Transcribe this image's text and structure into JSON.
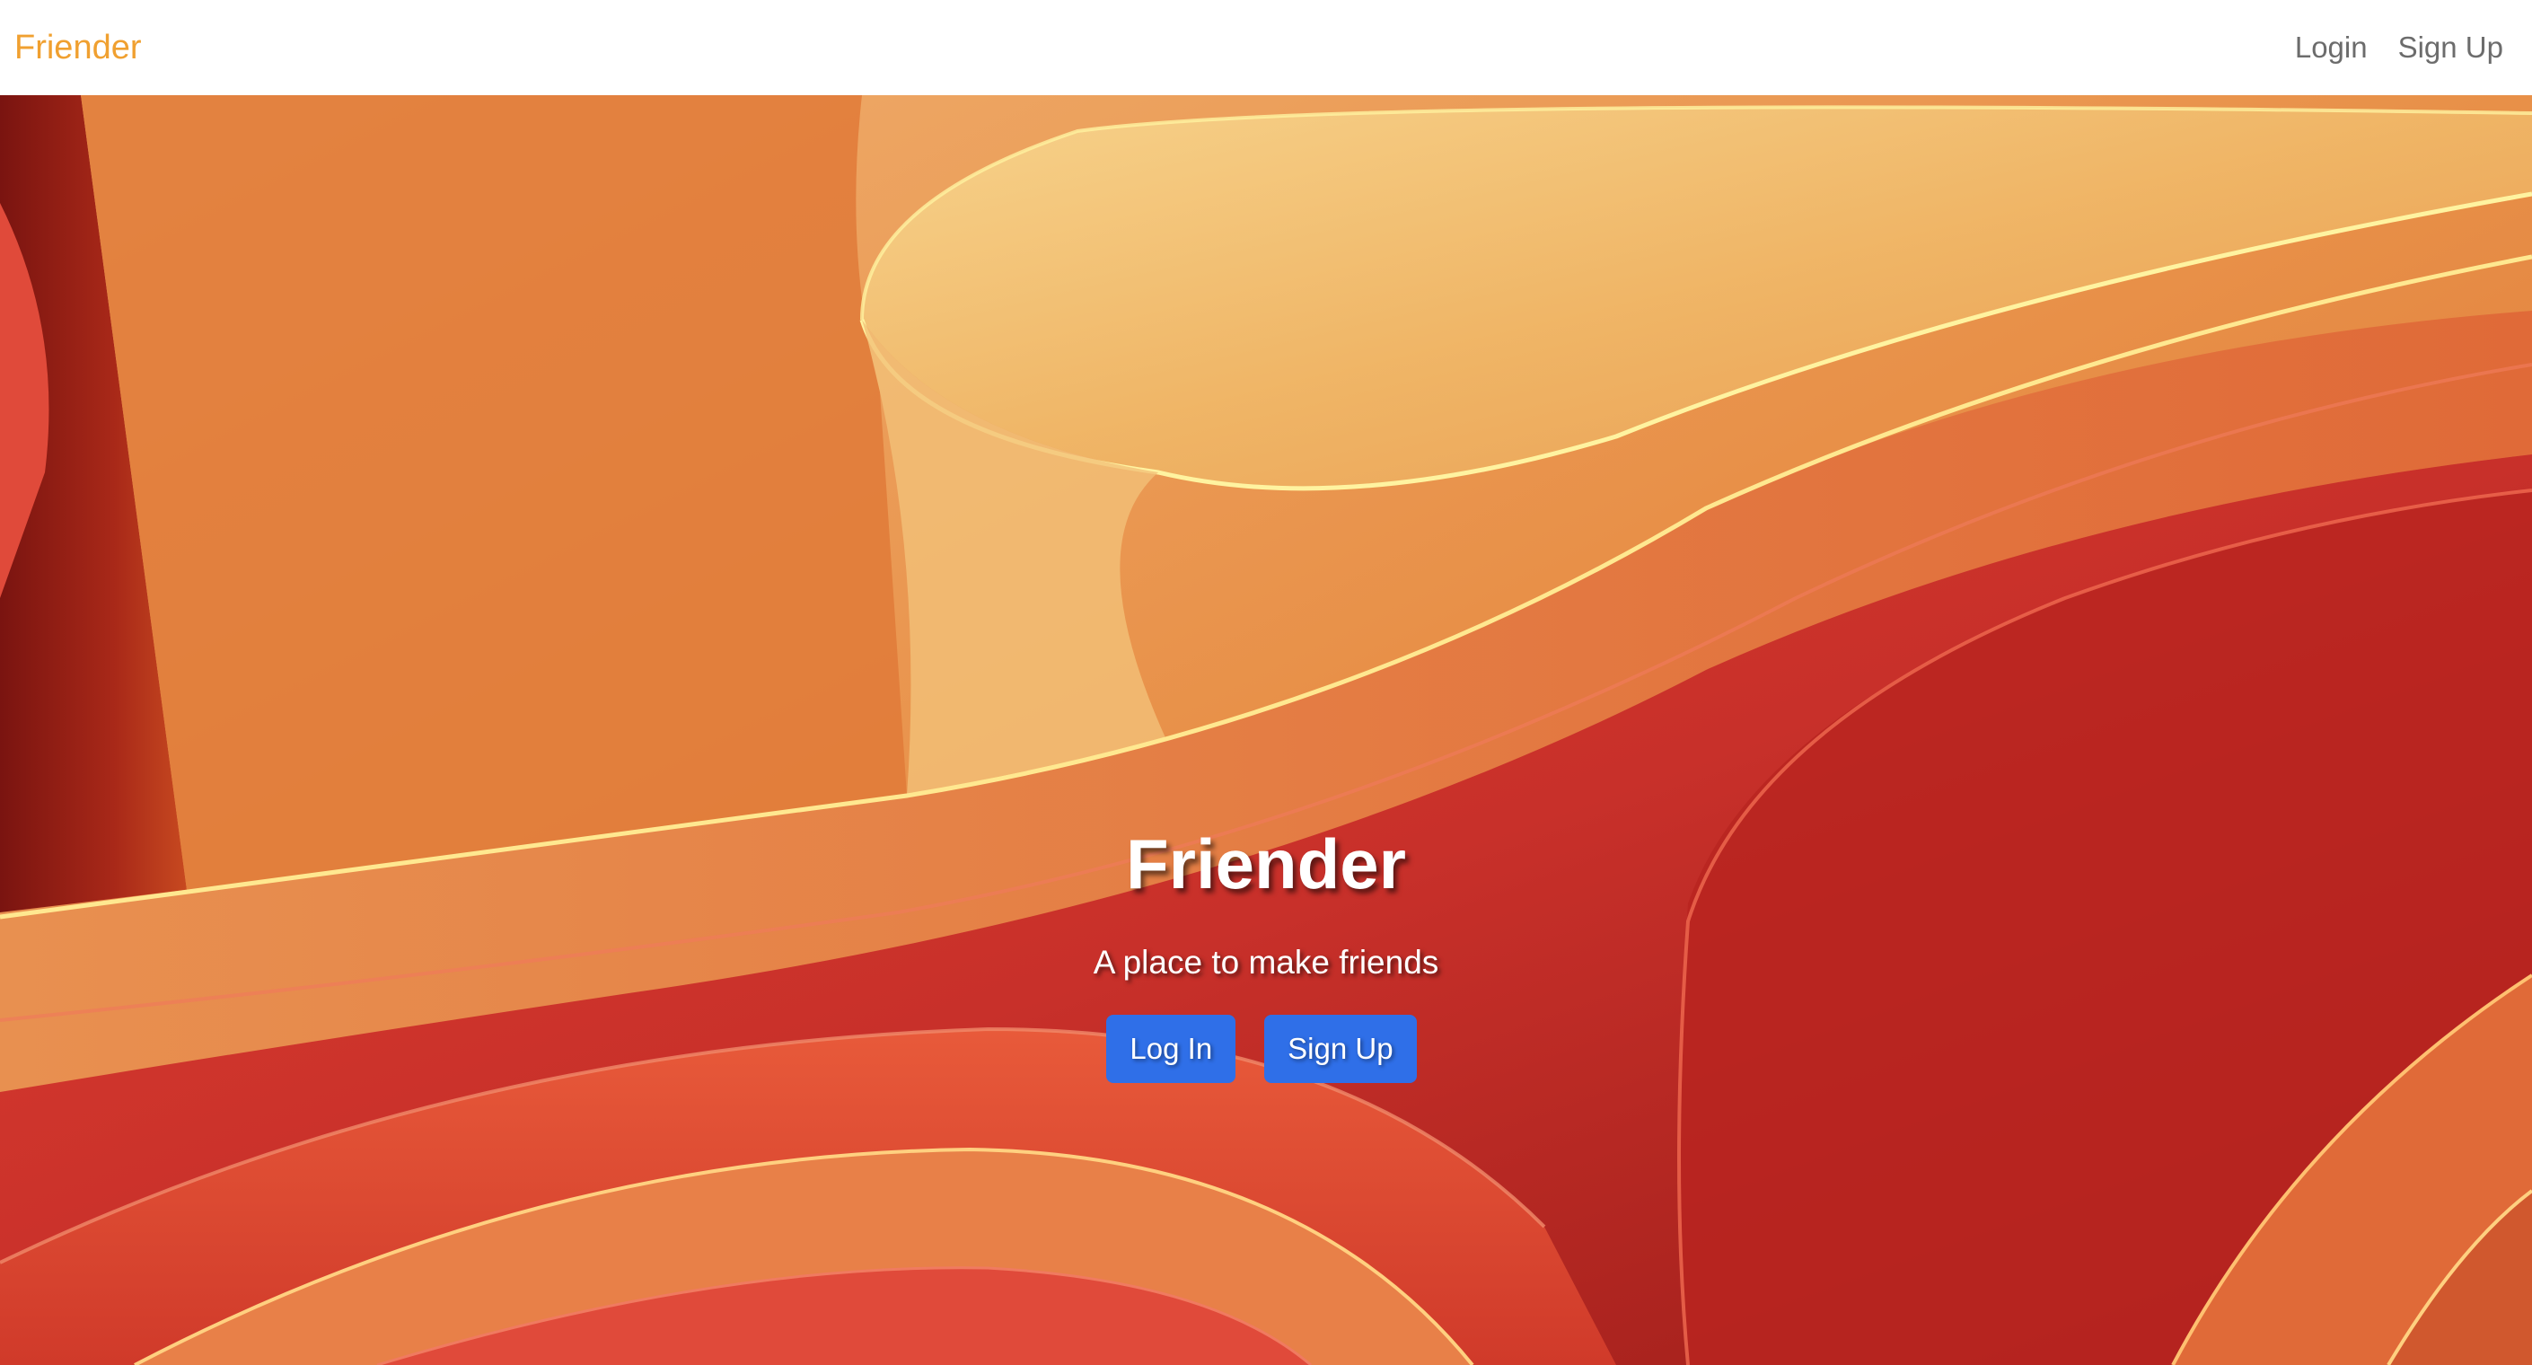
{
  "navbar": {
    "brand": "Friender",
    "links": {
      "login": "Login",
      "signup": "Sign Up"
    }
  },
  "hero": {
    "title": "Friender",
    "subtitle": "A place to make friends",
    "buttons": {
      "login": "Log In",
      "signup": "Sign Up"
    }
  },
  "colors": {
    "brand": "#f0a030",
    "button": "#2f6fe8",
    "nav_link": "#6c6c6c"
  }
}
